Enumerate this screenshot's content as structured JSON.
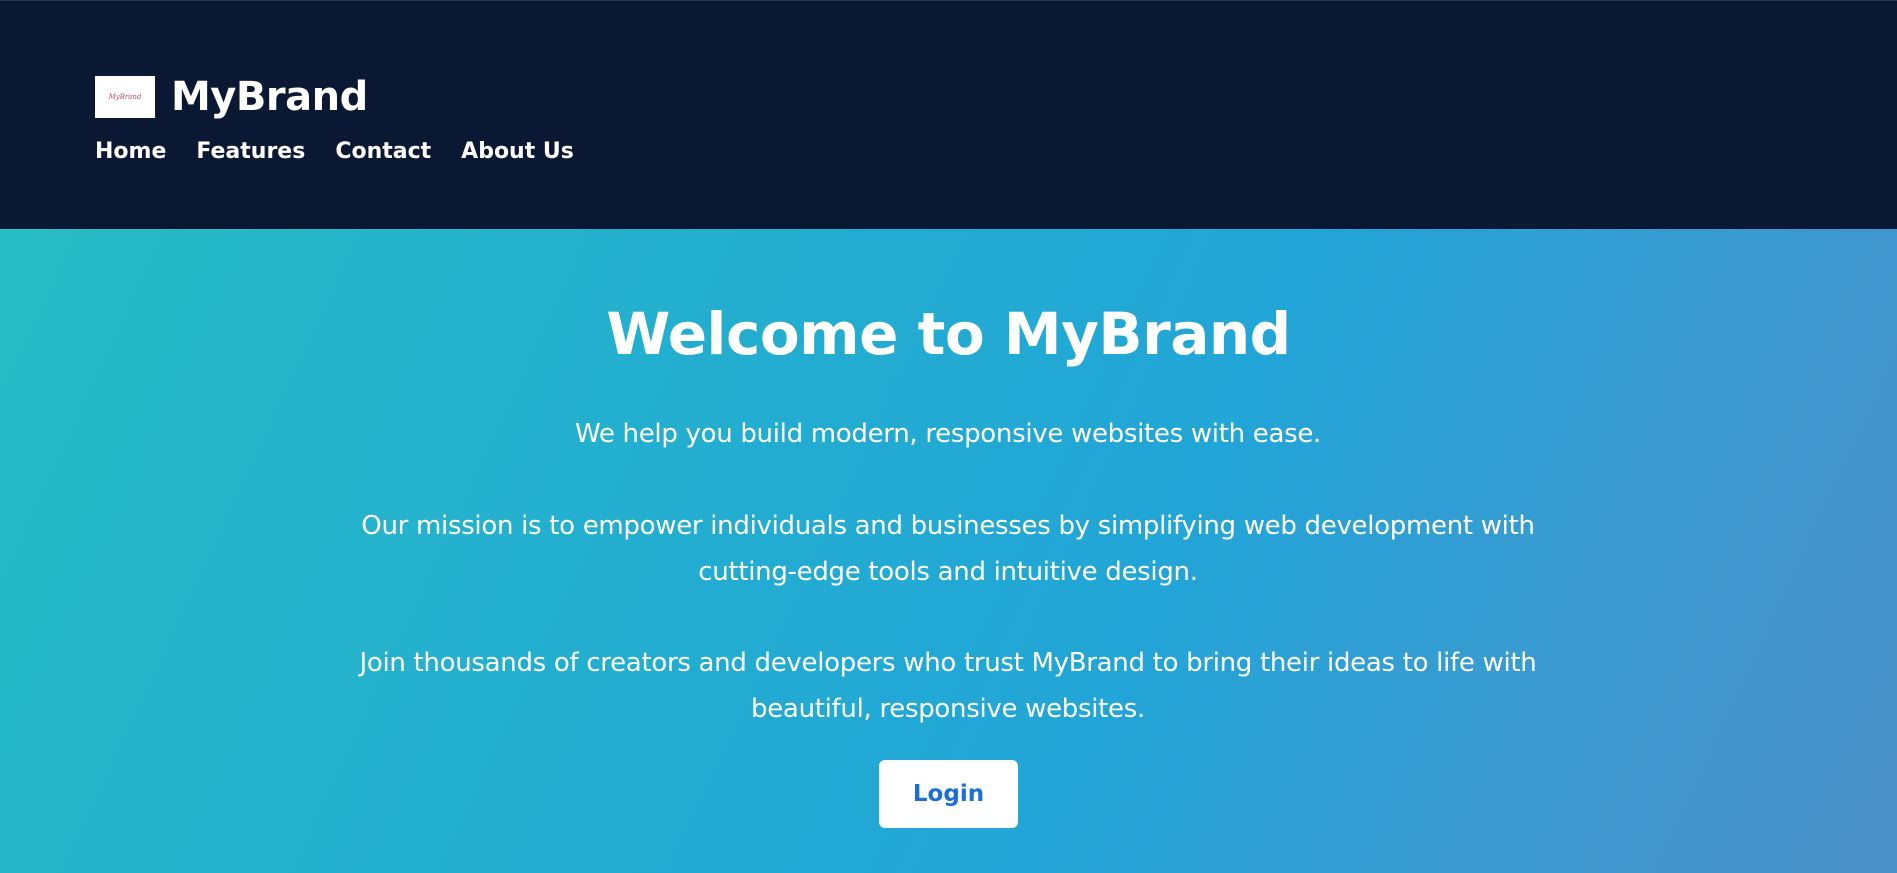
{
  "header": {
    "brand_name": "MyBrand",
    "logo_text": "MyBrand",
    "nav": [
      {
        "label": "Home"
      },
      {
        "label": "Features"
      },
      {
        "label": "Contact"
      },
      {
        "label": "About Us"
      }
    ]
  },
  "hero": {
    "title": "Welcome to MyBrand",
    "paragraphs": [
      "We help you build modern, responsive websites with ease.",
      "Our mission is to empower individuals and businesses by simplifying web development with cutting-edge tools and intuitive design.",
      "Join thousands of creators and developers who trust MyBrand to bring their ideas to life with beautiful, responsive websites."
    ],
    "login_label": "Login"
  },
  "colors": {
    "header_bg": "#0b1833",
    "hero_gradient_start": "#26bcc4",
    "hero_gradient_end": "#4b8fc7",
    "button_text": "#1a6fd6"
  }
}
